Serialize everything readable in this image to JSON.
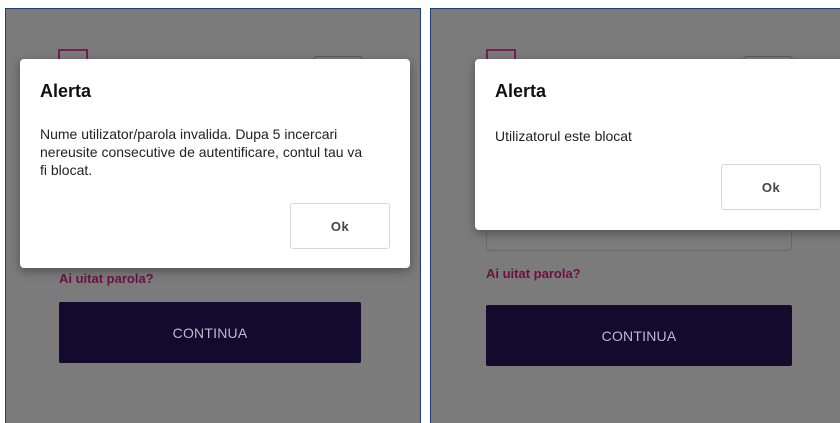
{
  "left_screen": {
    "forgot_password": "Ai uitat parola?",
    "continue_button": "CONTINUA",
    "alert": {
      "title": "Alerta",
      "message": "Nume utilizator/parola invalida. Dupa 5 incercari nereusite consecutive de autentificare, contul tau va fi blocat.",
      "ok_button": "Ok"
    }
  },
  "right_screen": {
    "forgot_password": "Ai uitat parola?",
    "continue_button": "CONTINUA",
    "alert": {
      "title": "Alerta",
      "message": "Utilizatorul este blocat",
      "ok_button": "Ok"
    }
  },
  "colors": {
    "overlay": "#7b7b7b",
    "primary_button": "#130a2e",
    "link": "#6e0f44",
    "panel_border": "#1f3f7a"
  }
}
